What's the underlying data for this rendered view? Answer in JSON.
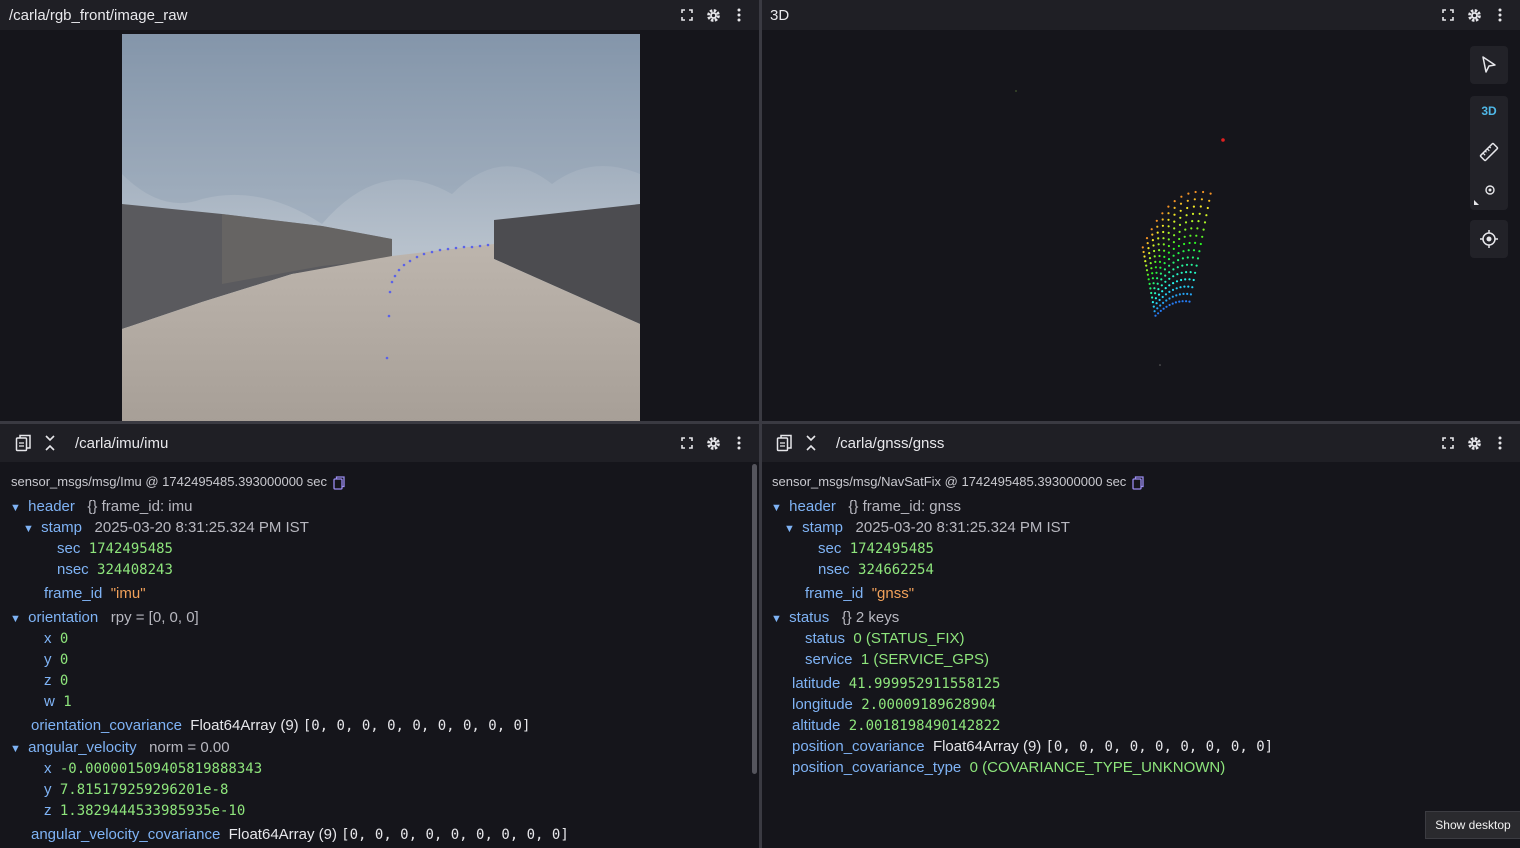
{
  "panels": {
    "image": {
      "title": "/carla/rgb_front/image_raw"
    },
    "three_d": {
      "title": "3D",
      "mode_label": "3D"
    },
    "imu": {
      "title": "/carla/imu/imu",
      "meta": "sensor_msgs/msg/Imu @ 1742495485.393000000 sec",
      "header_label": "header",
      "header_summary": "{} frame_id: imu",
      "stamp_label": "stamp",
      "stamp_value": "2025-03-20 8:31:25.324 PM IST",
      "sec_label": "sec",
      "sec_value": "1742495485",
      "nsec_label": "nsec",
      "nsec_value": "324408243",
      "frame_id_label": "frame_id",
      "frame_id_value": "\"imu\"",
      "orientation_label": "orientation",
      "orientation_summary": "rpy = [0, 0, 0]",
      "ox_label": "x",
      "ox": "0",
      "oy_label": "y",
      "oy": "0",
      "oz_label": "z",
      "oz": "0",
      "ow_label": "w",
      "ow": "1",
      "ocov_label": "orientation_covariance",
      "ocov_type": "Float64Array (9)",
      "ocov_value": "[0, 0, 0, 0, 0, 0, 0, 0, 0]",
      "angvel_label": "angular_velocity",
      "angvel_summary": "norm = 0.00",
      "avx_label": "x",
      "avx": "-0.0000015094058198883​43",
      "avy_label": "y",
      "avy": "7.815179259296201e-8",
      "avz_label": "z",
      "avz": "1.3829444533985935e-10",
      "avcov_label": "angular_velocity_covariance",
      "avcov_type": "Float64Array (9)",
      "avcov_value": "[0, 0, 0, 0, 0, 0, 0, 0, 0]"
    },
    "gnss": {
      "title": "/carla/gnss/gnss",
      "meta": "sensor_msgs/msg/NavSatFix @ 1742495485.393000000 sec",
      "header_label": "header",
      "header_summary": "{} frame_id: gnss",
      "stamp_label": "stamp",
      "stamp_value": "2025-03-20 8:31:25.324 PM IST",
      "sec_label": "sec",
      "sec_value": "1742495485",
      "nsec_label": "nsec",
      "nsec_value": "324662254",
      "frame_id_label": "frame_id",
      "frame_id_value": "\"gnss\"",
      "status_group_label": "status",
      "status_group_summary": "{} 2 keys",
      "status_label": "status",
      "status_value": "0 (STATUS_FIX)",
      "service_label": "service",
      "service_value": "1 (SERVICE_GPS)",
      "lat_label": "latitude",
      "lat": "41.999952911558125",
      "lon_label": "longitude",
      "lon": "2.00009189628904",
      "alt_label": "altitude",
      "alt": "2.0018198490142822",
      "pcov_label": "position_covariance",
      "pcov_type": "Float64Array (9)",
      "pcov_value": "[0, 0, 0, 0, 0, 0, 0, 0, 0]",
      "pcovt_label": "position_covariance_type",
      "pcovt_value": "0 (COVARIANCE_TYPE_UNKNOWN)"
    }
  },
  "tooltip": {
    "show_desktop": "Show desktop"
  },
  "icons": [
    "fullscreen-icon",
    "gear-icon",
    "more-vertical-icon",
    "copy-clipboard-icon",
    "collapse-icon",
    "pointer-icon",
    "ruler-icon",
    "target-icon",
    "locate-icon"
  ],
  "colors": {
    "background": "#15151b",
    "toolbar": "#1f1f25",
    "key": "#7fb3f5",
    "number": "#8ee57c",
    "string": "#f0a05a"
  }
}
